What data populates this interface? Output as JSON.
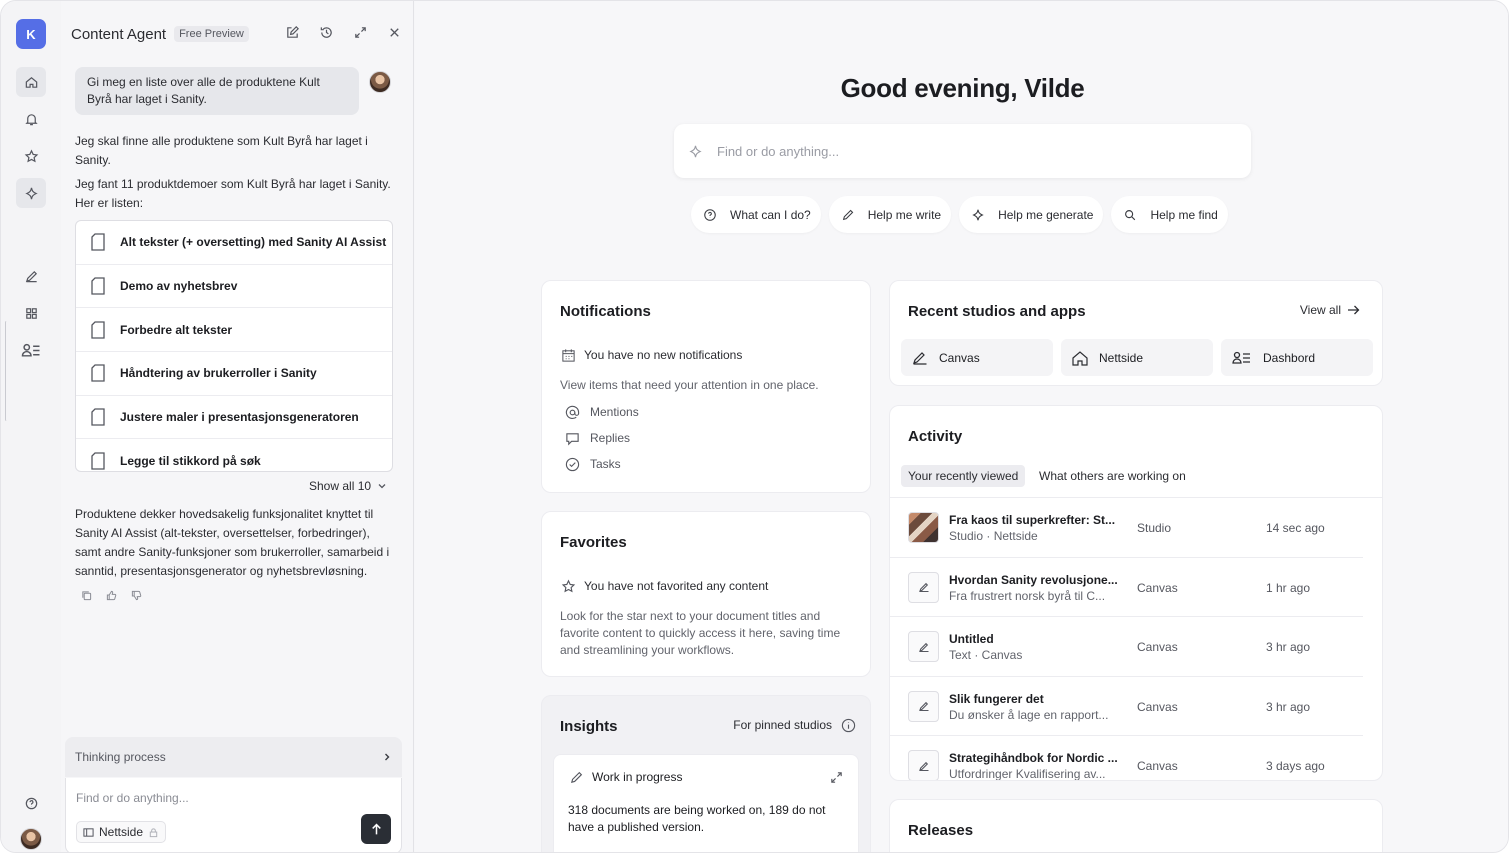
{
  "rail": {
    "logo_letter": "K",
    "items": [
      "home-icon",
      "bell-icon",
      "star-icon",
      "sparkle-icon",
      "canvas-icon",
      "grid-icon",
      "user-list-icon"
    ],
    "bottom": [
      "help-icon",
      "avatar"
    ]
  },
  "chat": {
    "title": "Content Agent",
    "badge": "Free Preview",
    "user_message": "Gi meg en liste over alle de produktene Kult Byrå har laget i Sanity.",
    "reply_1": "Jeg skal finne alle produktene som Kult Byrå har laget i Sanity.",
    "reply_2": "Jeg fant 11 produktdemoer som Kult Byrå har laget i Sanity. Her er listen:",
    "documents": [
      "Alt tekster (+ oversetting) med Sanity AI Assist",
      "Demo av nyhetsbrev",
      "Forbedre alt tekster",
      "Håndtering av brukerroller i Sanity",
      "Justere maler i presentasjonsgeneratoren",
      "Legge til stikkord på søk"
    ],
    "show_all": "Show all 10",
    "summary": "Produktene dekker hovedsakelig funksjonalitet knyttet til Sanity AI Assist (alt-tekster, oversettelser, forbedringer), samt andre Sanity-funksjoner som brukerroller, samarbeid i sanntid, presentasjonsgenerator og nyhetsbrevløsning.",
    "thinking": "Thinking process",
    "composer_placeholder": "Find or do anything...",
    "scope": "Nettside"
  },
  "main": {
    "greeting": "Good evening, Vilde",
    "search_placeholder": "Find or do anything...",
    "suggestions": [
      "What can I do?",
      "Help me write",
      "Help me generate",
      "Help me find"
    ],
    "notifications": {
      "title": "Notifications",
      "empty": "You have no new notifications",
      "hint": "View items that need your attention in one place.",
      "links": [
        "Mentions",
        "Replies",
        "Tasks"
      ]
    },
    "favorites": {
      "title": "Favorites",
      "empty": "You have not favorited any content",
      "hint": "Look for the star next to your document titles and favorite content to quickly access it here, saving time and streamlining your workflows."
    },
    "insights": {
      "title": "Insights",
      "scope": "For pinned studios",
      "wip_title": "Work in progress",
      "wip_text": "318 documents are being worked on, 189 do not have a published version."
    },
    "recent": {
      "title": "Recent studios and apps",
      "view_all": "View all",
      "apps": [
        "Canvas",
        "Nettside",
        "Dashbord"
      ]
    },
    "activity": {
      "title": "Activity",
      "tabs": [
        "Your recently viewed",
        "What others are working on"
      ],
      "rows": [
        {
          "title": "Fra kaos til superkrefter: St...",
          "sub": "Studio · Nettside",
          "type": "Studio",
          "time": "14 sec ago"
        },
        {
          "title": "Hvordan Sanity revolusjone...",
          "sub": "Fra frustrert norsk byrå til C...",
          "type": "Canvas",
          "time": "1 hr ago"
        },
        {
          "title": "Untitled",
          "sub": "Text · Canvas",
          "type": "Canvas",
          "time": "3 hr ago"
        },
        {
          "title": "Slik fungerer det",
          "sub": "Du ønsker å lage en rapport...",
          "type": "Canvas",
          "time": "3 hr ago"
        },
        {
          "title": "Strategihåndbok for Nordic ...",
          "sub": "Utfordringer Kvalifisering av...",
          "type": "Canvas",
          "time": "3 days ago"
        }
      ]
    },
    "releases": {
      "title": "Releases"
    }
  }
}
